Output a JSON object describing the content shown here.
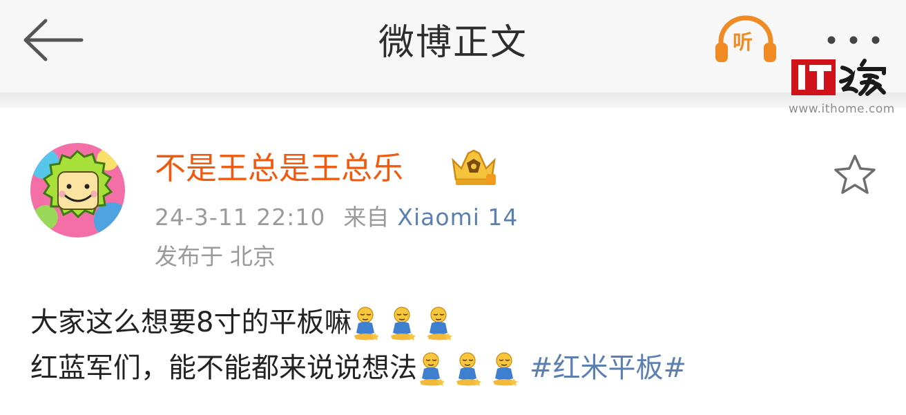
{
  "header": {
    "title": "微博正文",
    "listen_label": "听"
  },
  "watermark": {
    "logo_text": "IT之家",
    "url": "www.ithome.com"
  },
  "post": {
    "author": "不是王总是王总乐",
    "timestamp": "24-3-11 22:10",
    "source_prefix": "来自",
    "source_device": "Xiaomi 14",
    "location_prefix": "发布于",
    "location": "北京",
    "line1_text": "大家这么想要8寸的平板嘛",
    "line2_text": "红蓝军们，能不能都来说说想法",
    "hashtag": "#红米平板#",
    "emoji_name": "sitting-wait-emoji"
  },
  "colors": {
    "accent_orange": "#f05a0e",
    "listen_orange": "#f08a23",
    "link_blue": "#5b7fb0",
    "meta_gray": "#9a9a9a",
    "watermark_red": "#d0121b"
  }
}
